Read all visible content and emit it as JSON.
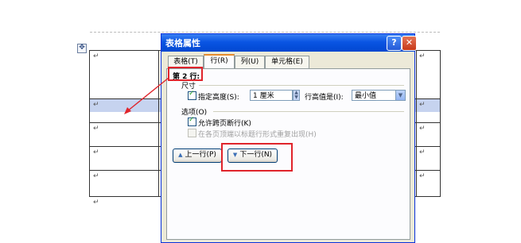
{
  "dialog": {
    "title": "表格属性",
    "help_glyph": "?",
    "close_glyph": "✕"
  },
  "tabs": [
    {
      "label": "表格(T)"
    },
    {
      "label": "行(R)"
    },
    {
      "label": "列(U)"
    },
    {
      "label": "单元格(E)"
    }
  ],
  "row_panel": {
    "row_indicator": "第 2 行:",
    "size_group": "尺寸",
    "specify_height_label": "指定高度(S):",
    "specify_height_checked": true,
    "height_value": "1 厘米",
    "row_height_is_label": "行高值是(I):",
    "row_height_mode": "最小值",
    "options_group": "选项(O)",
    "allow_break_label": "允许跨页断行(K)",
    "allow_break_checked": true,
    "repeat_header_label": "在各页顶端以标题行形式重复出现(H)",
    "repeat_header_checked": false
  },
  "nav": {
    "prev_row": "上一行(P)",
    "next_row": "下一行(N)"
  },
  "document": {
    "move_handle_glyph": "✥",
    "cell_mark": "↵"
  },
  "colors": {
    "annotation": "#e0242b",
    "selected_row": "#c6d3ef",
    "titlebar": "#0a55e3"
  }
}
